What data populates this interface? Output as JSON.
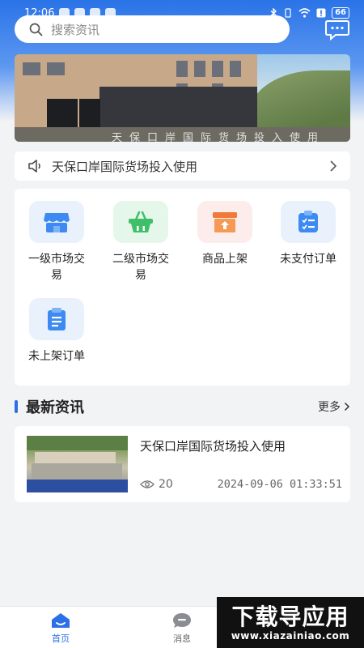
{
  "status_bar": {
    "time": "12:06",
    "battery": "66"
  },
  "search": {
    "placeholder": "搜索资讯",
    "icon": "search-icon"
  },
  "header": {
    "chat_icon": "chat-bubble-icon"
  },
  "banner": {
    "caption": "天保口岸国际货场投入使用"
  },
  "notice": {
    "text": "天保口岸国际货场投入使用",
    "icon": "speaker-icon",
    "arrow_icon": "chevron-right-icon"
  },
  "grid": {
    "items": [
      {
        "label": "一级市场交易",
        "icon": "market-stall-icon",
        "color": "#3d8bf2",
        "bg": "#e9f1fd"
      },
      {
        "label": "二级市场交易",
        "icon": "shopping-basket-icon",
        "color": "#3fbf6a",
        "bg": "#e5f7ea"
      },
      {
        "label": "商品上架",
        "icon": "shelf-box-icon",
        "color": "#f07a3a",
        "bg": "#fdecec"
      },
      {
        "label": "未支付订单",
        "icon": "unpaid-order-icon",
        "color": "#3d8bf2",
        "bg": "#e9f1fd"
      },
      {
        "label": "未上架订单",
        "icon": "clipboard-icon",
        "color": "#3d8bf2",
        "bg": "#e9f1fd"
      }
    ]
  },
  "news_section": {
    "title": "最新资讯",
    "more": "更多"
  },
  "news": [
    {
      "title": "天保口岸国际货场投入使用",
      "views": "20",
      "date": "2024-09-06 01:33:51"
    }
  ],
  "tabbar": {
    "tabs": [
      {
        "label": "首页",
        "icon": "home-icon",
        "active": true
      },
      {
        "label": "消息",
        "icon": "message-icon",
        "active": false
      }
    ],
    "active_color": "#2d6fe6"
  },
  "watermark": {
    "main": "下载导应用",
    "url": "www.xiazainiao.com"
  }
}
